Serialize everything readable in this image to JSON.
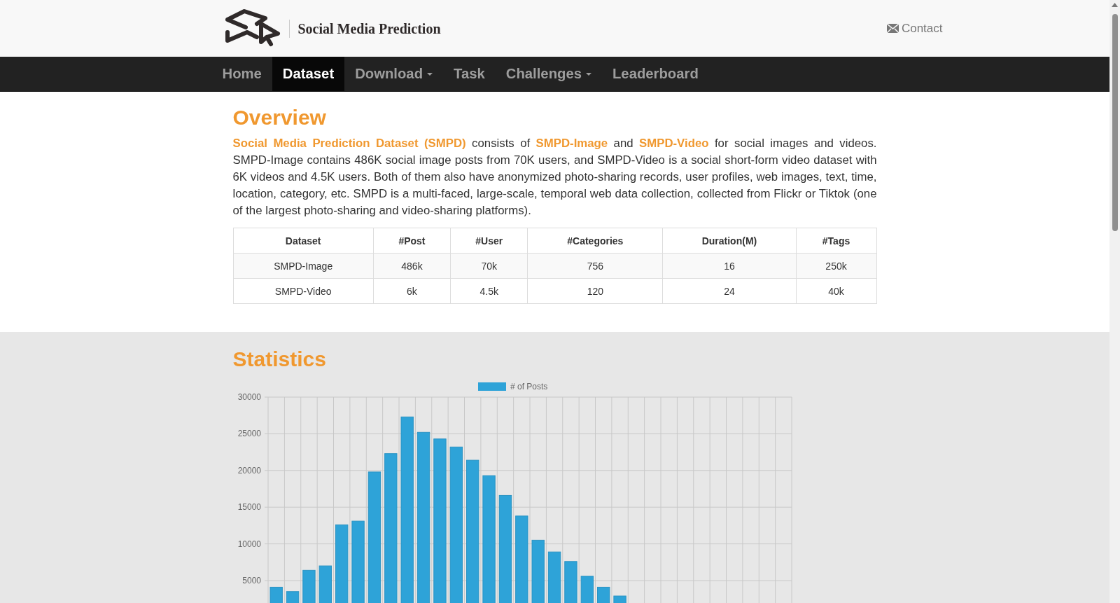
{
  "header": {
    "brand": "Social Media Prediction",
    "contact": "Contact"
  },
  "nav": [
    {
      "label": "Home",
      "selected": false,
      "dropdown": false
    },
    {
      "label": "Dataset",
      "selected": true,
      "dropdown": false
    },
    {
      "label": "Download",
      "selected": false,
      "dropdown": true
    },
    {
      "label": "Task",
      "selected": false,
      "dropdown": false
    },
    {
      "label": "Challenges",
      "selected": false,
      "dropdown": true
    },
    {
      "label": "Leaderboard",
      "selected": false,
      "dropdown": false
    }
  ],
  "overview": {
    "title": "Overview",
    "paragraph": [
      {
        "text": "Social Media Prediction Dataset (SMPD)",
        "link": true
      },
      {
        "text": " consists of ",
        "link": false
      },
      {
        "text": "SMPD-Image",
        "link": true
      },
      {
        "text": " and ",
        "link": false
      },
      {
        "text": "SMPD-Video",
        "link": true
      },
      {
        "text": " for social images and videos. SMPD-Image contains 486K social image posts from 70K users, and SMPD-Video is a social short-form video dataset with 6K videos and 4.5K users. Both of them also have anonymized photo-sharing records, user profiles, web images, text, time, location, category, etc. SMPD is a multi-faced, large-scale, temporal web data collection, collected from Flickr or Tiktok (one of the largest photo-sharing and video-sharing platforms).",
        "link": false
      }
    ],
    "table": {
      "columns": [
        "Dataset",
        "#Post",
        "#User",
        "#Categories",
        "Duration(M)",
        "#Tags"
      ],
      "rows": [
        [
          "SMPD-Image",
          "486k",
          "70k",
          "756",
          "16",
          "250k"
        ],
        [
          "SMPD-Video",
          "6k",
          "4.5k",
          "120",
          "24",
          "40k"
        ]
      ]
    }
  },
  "statistics": {
    "title": "Statistics",
    "chart_data": {
      "type": "bar",
      "grid": true,
      "ylim": [
        0,
        30000
      ],
      "yticks": [
        5000,
        10000,
        15000,
        20000,
        25000,
        30000
      ],
      "series": [
        {
          "name": "# of Posts",
          "color": "#2ea3d8",
          "values": [
            4100,
            3500,
            6400,
            7000,
            12600,
            13100,
            19800,
            22300,
            27300,
            25200,
            24300,
            23200,
            21400,
            19300,
            16600,
            13800,
            10500,
            8900,
            7600,
            5600,
            4100,
            2900,
            null,
            null,
            null,
            null,
            null,
            null,
            null,
            null,
            null,
            null
          ]
        }
      ]
    }
  }
}
